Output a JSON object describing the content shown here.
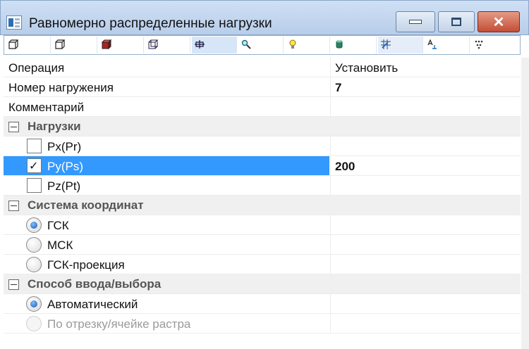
{
  "window": {
    "title": "Равномерно распределенные нагрузки",
    "minimize_symbol": "",
    "maximize_symbol": "",
    "close_symbol": "✕"
  },
  "toolbar": {
    "tools": [
      "cube-icon",
      "cube-outline-icon",
      "cube-red-icon",
      "cube-wire-icon",
      "grid-icon",
      "magnifier-icon",
      "bulb-icon",
      "cylinder-icon",
      "grid-brush-icon",
      "text-icon",
      "dots-icon"
    ],
    "selected_index": 4
  },
  "rows": {
    "operation": {
      "label": "Операция",
      "value": "Установить"
    },
    "load_number": {
      "label": "Номер нагружения",
      "value": "7"
    },
    "comment": {
      "label": "Комментарий",
      "value": ""
    }
  },
  "loads": {
    "title": "Нагрузки",
    "items": [
      {
        "label": "Px(Pr)",
        "checked": false,
        "value": ""
      },
      {
        "label": "Py(Ps)",
        "checked": true,
        "value": "200"
      },
      {
        "label": "Pz(Pt)",
        "checked": false,
        "value": ""
      }
    ],
    "check_symbol": "✓"
  },
  "coord_system": {
    "title": "Система координат",
    "options": [
      {
        "label": "ГСК",
        "selected": true
      },
      {
        "label": "МСК",
        "selected": false
      },
      {
        "label": "ГСК-проекция",
        "selected": false
      }
    ]
  },
  "input_method": {
    "title": "Способ ввода/выбора",
    "options": [
      {
        "label": "Автоматический",
        "selected": true,
        "enabled": true
      },
      {
        "label": "По отрезку/ячейке растра",
        "selected": false,
        "enabled": false
      }
    ]
  },
  "colors": {
    "selection": "#3399ff",
    "category_bg": "#f0f0f0",
    "close_button": "#c24d36"
  }
}
